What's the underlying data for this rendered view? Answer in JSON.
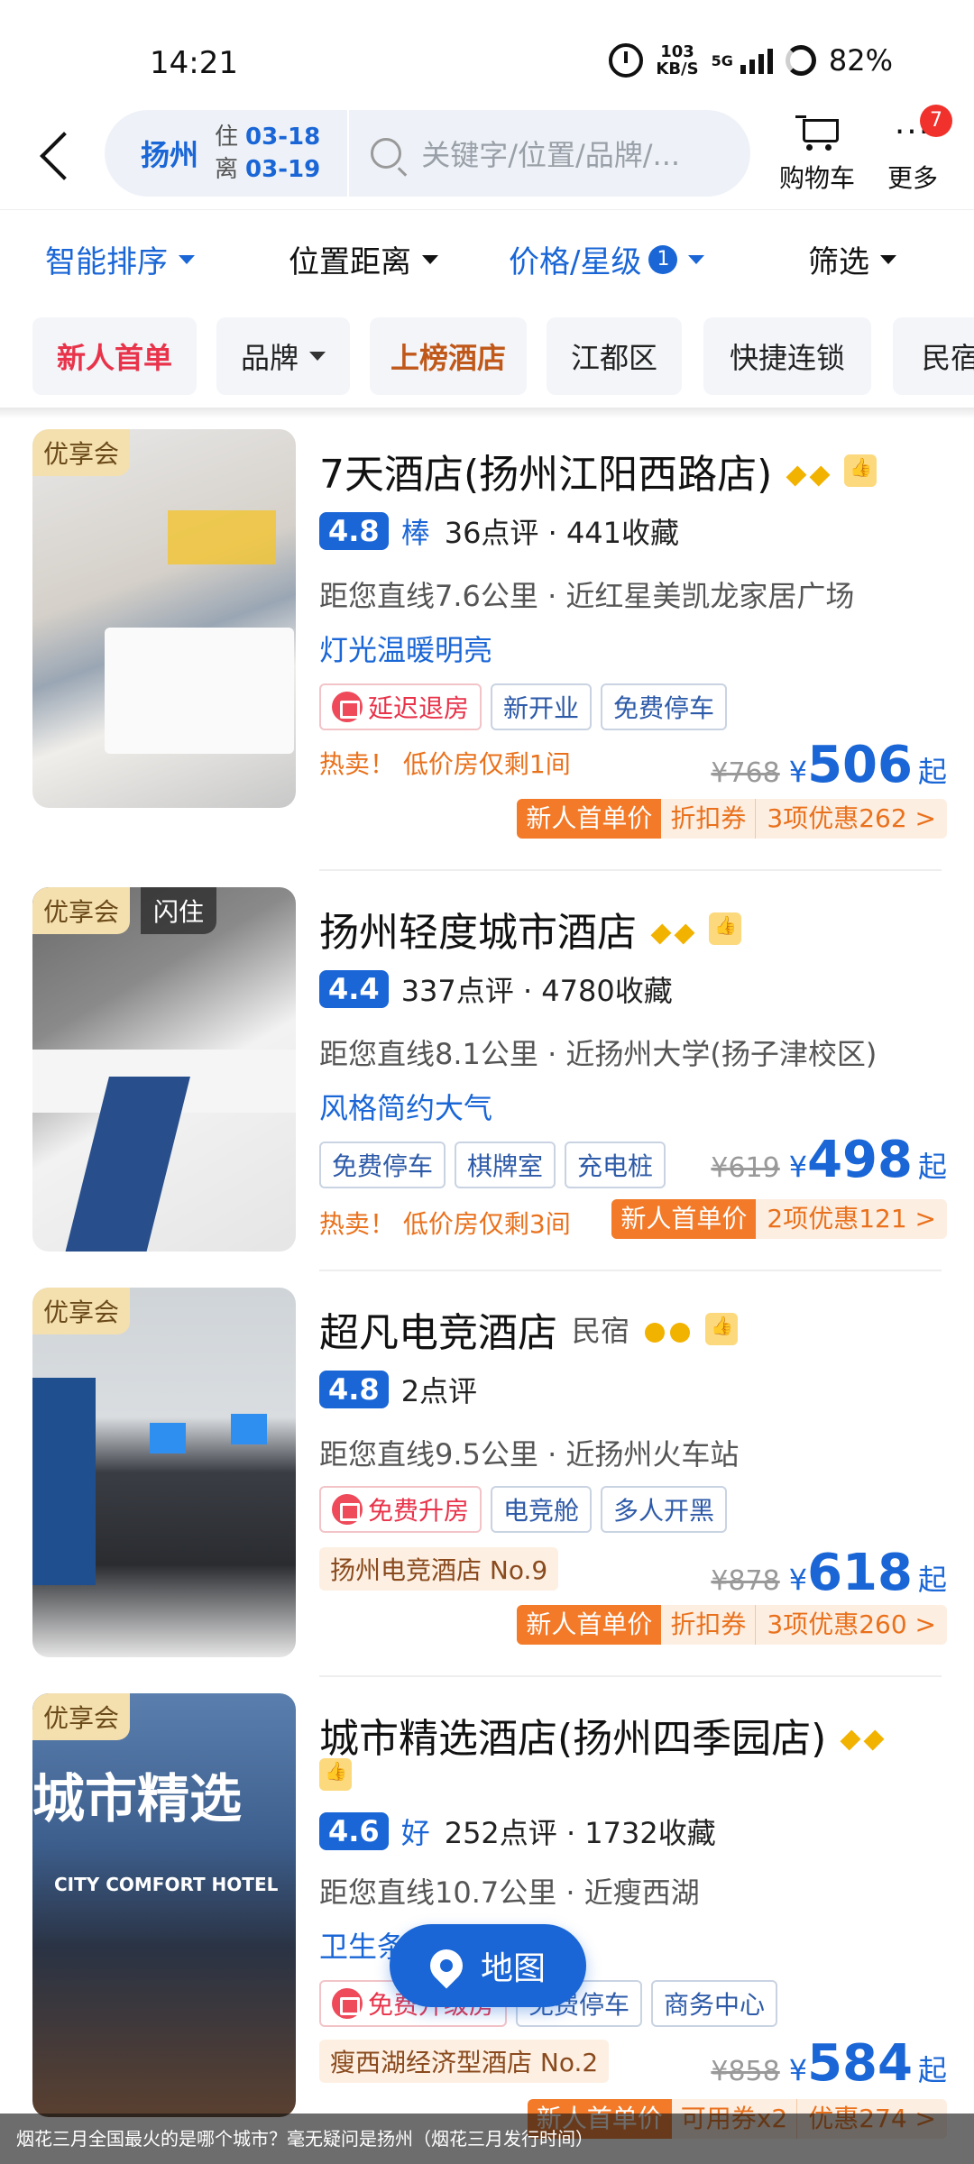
{
  "status_bar": {
    "time": "14:21",
    "speed_value": "103",
    "speed_unit": "KB/S",
    "network": "5G",
    "battery": "82%"
  },
  "header": {
    "city": "扬州",
    "checkin_label": "住",
    "checkin_date": "03-18",
    "checkout_label": "离",
    "checkout_date": "03-19",
    "search_placeholder": "关键字/位置/品牌/...",
    "cart_label": "购物车",
    "more_label": "更多",
    "more_badge": "7"
  },
  "sort_bar": {
    "smart_sort": "智能排序",
    "distance": "位置距离",
    "price_star": "价格/星级",
    "price_star_badge": "1",
    "filter": "筛选"
  },
  "chips": [
    "新人首单",
    "品牌",
    "上榜酒店",
    "江都区",
    "快捷连锁",
    "民宿"
  ],
  "hotels": [
    {
      "tag": "优享会",
      "name": "7天酒店(扬州江阳西路店)",
      "score": "4.8",
      "score_word": "棒",
      "reviews": "36点评 · 441收藏",
      "distance": "距您直线7.6公里 · 近红星美凯龙家居广场",
      "feature": "灯光温暖明亮",
      "tags": [
        "延迟退房",
        "新开业",
        "免费停车"
      ],
      "hot": "热卖！ 低价房仅剩1间",
      "orig_price": "¥768",
      "yen": "¥",
      "price": "506",
      "qi": "起",
      "promo": [
        "新人首单价",
        "折扣券",
        "3项优惠262 >"
      ]
    },
    {
      "tag": "优享会",
      "tag2": "闪住",
      "name": "扬州轻度城市酒店",
      "score": "4.4",
      "reviews": "337点评 · 4780收藏",
      "distance": "距您直线8.1公里 · 近扬州大学(扬子津校区)",
      "feature": "风格简约大气",
      "tags": [
        "免费停车",
        "棋牌室",
        "充电桩"
      ],
      "hot": "热卖！ 低价房仅剩3间",
      "orig_price": "¥619",
      "yen": "¥",
      "price": "498",
      "qi": "起",
      "promo": [
        "新人首单价",
        "2项优惠121 >"
      ]
    },
    {
      "tag": "优享会",
      "name": "超凡电竞酒店",
      "type_label": "民宿",
      "score": "4.8",
      "reviews": "2点评",
      "distance": "距您直线9.5公里 · 近扬州火车站",
      "tags": [
        "免费升房",
        "电竞舱",
        "多人开黑"
      ],
      "rank": "扬州电竞酒店 No.9",
      "orig_price": "¥878",
      "yen": "¥",
      "price": "618",
      "qi": "起",
      "promo": [
        "新人首单价",
        "折扣券",
        "3项优惠260 >"
      ]
    },
    {
      "tag": "优享会",
      "name": "城市精选酒店(扬州四季园店)",
      "score": "4.6",
      "score_word": "好",
      "reviews": "252点评 · 1732收藏",
      "distance": "距您直线10.7公里 · 近瘦西湖",
      "feature": "卫生条",
      "tags": [
        "免费升级房",
        "免费停车",
        "商务中心"
      ],
      "rank": "瘦西湖经济型酒店 No.2",
      "orig_price": "¥858",
      "yen": "¥",
      "price": "584",
      "qi": "起",
      "promo": [
        "新人首单价",
        "可用券x2",
        "优惠274 >"
      ],
      "sign_text": "城市精选",
      "sign_en": "CITY COMFORT HOTEL"
    }
  ],
  "map_button": "地图",
  "caption": "烟花三月全国最火的是哪个城市？毫无疑问是扬州（烟花三月发行时间）"
}
